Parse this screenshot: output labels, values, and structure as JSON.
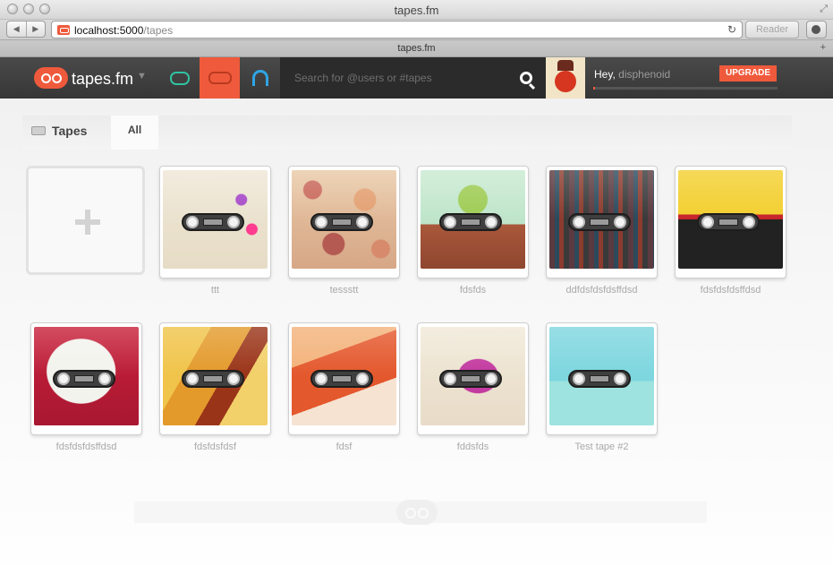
{
  "window": {
    "title": "tapes.fm",
    "tab_title": "tapes.fm",
    "back_icon": "back-arrow-icon",
    "forward_icon": "forward-arrow-icon",
    "url_host": "localhost:5000",
    "url_path": "/tapes",
    "reload_glyph": "↻",
    "reader_label": "Reader",
    "nav_back_glyph": "◀",
    "nav_forward_glyph": "▶",
    "resize_glyph": "⤢",
    "new_tab_glyph": "+"
  },
  "nav": {
    "brand": "tapes.fm",
    "brand_caret": "▼",
    "search_placeholder": "Search for @users or #tapes",
    "greeting": "Hey,",
    "username": "disphenoid",
    "upgrade_label": "UPGRADE",
    "progress_fraction": 0.01,
    "colors": {
      "accent": "#ef5a3c",
      "chat": "#30c2a0",
      "listen": "#2fa5e4"
    }
  },
  "page": {
    "section_title": "Tapes",
    "filter_tab": "All"
  },
  "tapes": [
    {
      "name": "ttt",
      "art": "bird"
    },
    {
      "name": "tessstt",
      "art": "pebbles"
    },
    {
      "name": "fdsfds",
      "art": "cactus"
    },
    {
      "name": "ddfdsfdsfdsffdsd",
      "art": "books"
    },
    {
      "name": "fdsfdsfdsffdsd",
      "art": "poster"
    },
    {
      "name": "fdsfdsfdsffdsd",
      "art": "bubble"
    },
    {
      "name": "fdsfdsfdsf",
      "art": "tentacles"
    },
    {
      "name": "fdsf",
      "art": "z"
    },
    {
      "name": "fddsfds",
      "art": "radio"
    },
    {
      "name": "Test tape #2",
      "art": "windsock"
    }
  ]
}
